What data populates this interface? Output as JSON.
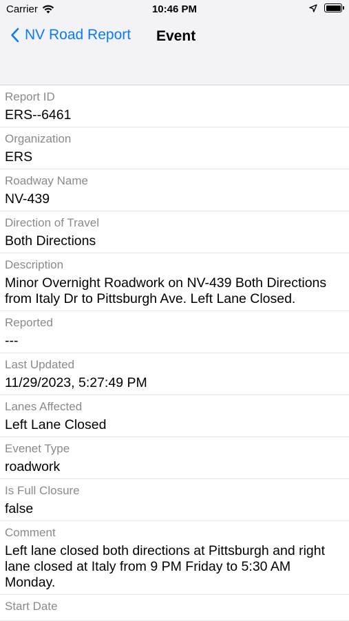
{
  "status_bar": {
    "carrier": "Carrier",
    "time": "10:46 PM"
  },
  "nav": {
    "back_label": "NV Road Report",
    "title": "Event"
  },
  "fields": [
    {
      "label": "Report ID",
      "value": "ERS--6461"
    },
    {
      "label": "Organization",
      "value": "ERS"
    },
    {
      "label": "Roadway Name",
      "value": "NV-439"
    },
    {
      "label": "Direction of Travel",
      "value": "Both Directions"
    },
    {
      "label": "Description",
      "value": "Minor Overnight Roadwork on NV-439 Both Directions from Italy Dr to Pittsburgh Ave. Left Lane Closed."
    },
    {
      "label": "Reported",
      "value": "---"
    },
    {
      "label": "Last Updated",
      "value": "11/29/2023, 5:27:49 PM"
    },
    {
      "label": "Lanes Affected",
      "value": "Left Lane Closed"
    },
    {
      "label": "Evenet Type",
      "value": "roadwork"
    },
    {
      "label": "Is Full Closure",
      "value": "false"
    },
    {
      "label": "Comment",
      "value": "Left lane closed both directions at Pittsburgh and right lane closed at Italy from 9 PM Friday to 5:30 AM Monday."
    },
    {
      "label": "Start Date",
      "value": ""
    }
  ],
  "colors": {
    "accent": "#0a7aff",
    "label_gray": "#8a8a8e",
    "header_bg": "#f2f2f7"
  },
  "icons": [
    "wifi-icon",
    "location-arrow-icon",
    "battery-icon",
    "chevron-left-icon"
  ]
}
